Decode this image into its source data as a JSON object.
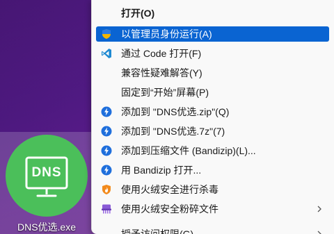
{
  "desktop": {
    "icon_text": "DNS",
    "icon_label": "DNS优选.exe"
  },
  "context_menu": {
    "items": [
      {
        "label": "打开(O)",
        "icon": "none"
      },
      {
        "label": "以管理员身份运行(A)",
        "icon": "uac-shield-icon"
      },
      {
        "label": "通过 Code 打开(F)",
        "icon": "vscode-icon"
      },
      {
        "label": "兼容性疑难解答(Y)",
        "icon": "none"
      },
      {
        "label": "固定到“开始”屏幕(P)",
        "icon": "none"
      },
      {
        "label": "添加到 \"DNS优选.zip\"(Q)",
        "icon": "bandizip-icon"
      },
      {
        "label": "添加到 \"DNS优选.7z\"(7)",
        "icon": "bandizip-icon"
      },
      {
        "label": "添加到压缩文件 (Bandizip)(L)...",
        "icon": "bandizip-icon"
      },
      {
        "label": "用 Bandizip 打开...",
        "icon": "bandizip-icon"
      },
      {
        "label": "使用火绒安全进行杀毒",
        "icon": "huorong-icon"
      },
      {
        "label": "使用火绒安全粉碎文件",
        "icon": "shredder-icon"
      },
      {
        "label": "授予访问权限(G)",
        "icon": "none"
      }
    ]
  },
  "colors": {
    "selection": "#0a64d2",
    "dns_green": "#4bbf5a",
    "bandizip_blue": "#1f6fdc"
  }
}
